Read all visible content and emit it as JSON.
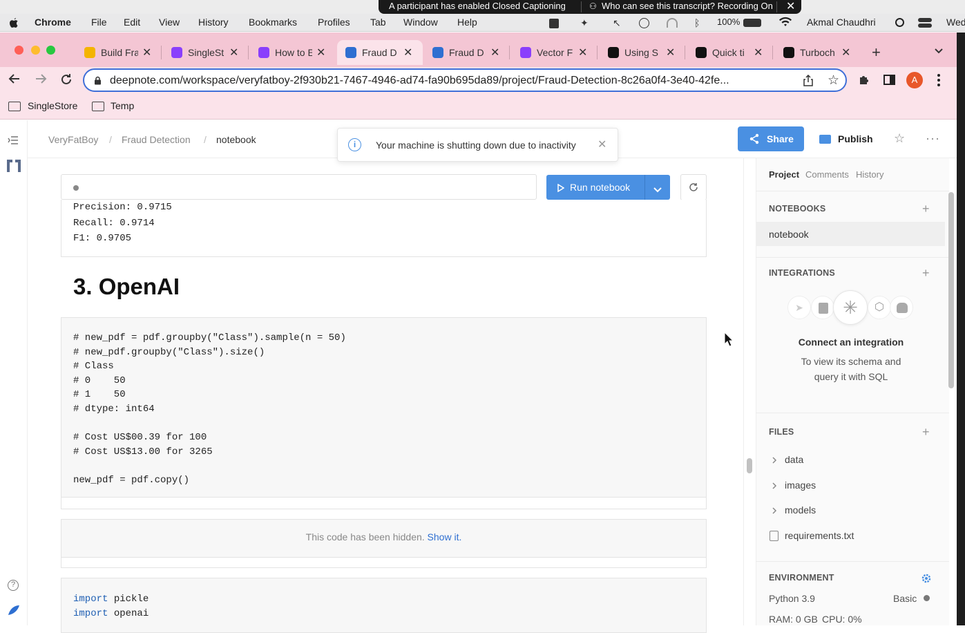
{
  "os_menubar": {
    "apple": "",
    "app_name": "Chrome",
    "menus": [
      "File",
      "Edit",
      "View",
      "History",
      "Bookmarks",
      "Profiles",
      "Tab",
      "Window",
      "Help"
    ],
    "battery": "100%",
    "user": "Akmal Chaudhri",
    "clock_fragment": "Wed"
  },
  "caption_banner": {
    "left_text": "A participant has enabled Closed Captioning",
    "right_text": "Who can see this transcript? Recording On"
  },
  "tabs": [
    {
      "title": "Build Fra",
      "favicon_color": "#f4b400",
      "active": false
    },
    {
      "title": "SingleSt",
      "favicon_color": "#8a3ffc",
      "active": false
    },
    {
      "title": "How to E",
      "favicon_color": "#8a3ffc",
      "active": false
    },
    {
      "title": "Fraud D",
      "favicon_color": "#2e6fd1",
      "active": true
    },
    {
      "title": "Fraud D",
      "favicon_color": "#2e6fd1",
      "active": false
    },
    {
      "title": "Vector F",
      "favicon_color": "#8a3ffc",
      "active": false
    },
    {
      "title": "Using S",
      "favicon_color": "#111111",
      "active": false
    },
    {
      "title": "Quick ti",
      "favicon_color": "#111111",
      "active": false
    },
    {
      "title": "Turboch",
      "favicon_color": "#111111",
      "active": false
    }
  ],
  "toolbar": {
    "url": "deepnote.com/workspace/veryfatboy-2f930b21-7467-4946-ad74-fa90b695da89/project/Fraud-Detection-8c26a0f4-3e40-42fe...",
    "profile_initial": "A"
  },
  "bookmarks": [
    {
      "label": "SingleStore"
    },
    {
      "label": "Temp"
    }
  ],
  "breadcrumb": {
    "workspace": "VeryFatBoy",
    "project": "Fraud Detection",
    "notebook": "notebook",
    "separator": "/"
  },
  "toast": {
    "message": "Your machine is shutting down due to inactivity"
  },
  "header_actions": {
    "share_label": "Share",
    "publish_label": "Publish"
  },
  "run_bar": {
    "run_label": "Run notebook"
  },
  "output_cell": {
    "lines": [
      "Precision: 0.9715",
      "Recall: 0.9714",
      "F1: 0.9705"
    ]
  },
  "heading": "3. OpenAI",
  "code_cell_1": {
    "lines": [
      "# new_pdf = pdf.groupby(\"Class\").sample(n = 50)",
      "# new_pdf.groupby(\"Class\").size()",
      "# Class",
      "# 0    50",
      "# 1    50",
      "# dtype: int64",
      "",
      "# Cost US$00.39 for 100",
      "# Cost US$13.00 for 3265",
      "",
      "new_pdf = pdf.copy()"
    ]
  },
  "hidden_cell": {
    "text": "This code has been hidden.",
    "link": "Show it."
  },
  "code_cell_2": {
    "lines": [
      {
        "kw": "import",
        "rest": " pickle"
      },
      {
        "kw": "import",
        "rest": " openai"
      }
    ]
  },
  "right_panel": {
    "tabs": [
      "Project",
      "Comments",
      "History"
    ],
    "notebooks_title": "NOTEBOOKS",
    "notebooks": [
      "notebook"
    ],
    "integrations_title": "INTEGRATIONS",
    "integration_cta_title": "Connect an integration",
    "integration_cta_line1": "To view its schema and",
    "integration_cta_line2": "query it with SQL",
    "files_title": "FILES",
    "files": [
      {
        "name": "data",
        "type": "folder"
      },
      {
        "name": "images",
        "type": "folder"
      },
      {
        "name": "models",
        "type": "folder"
      },
      {
        "name": "requirements.txt",
        "type": "file"
      }
    ],
    "environment_title": "ENVIRONMENT",
    "python_version": "Python 3.9",
    "machine": "Basic",
    "ram": "RAM: 0 GB",
    "cpu": "CPU: 0%"
  },
  "colors": {
    "accent": "#4a90e2",
    "tabstrip": "#f4c6d4",
    "toolbar": "#fbe3ea"
  }
}
